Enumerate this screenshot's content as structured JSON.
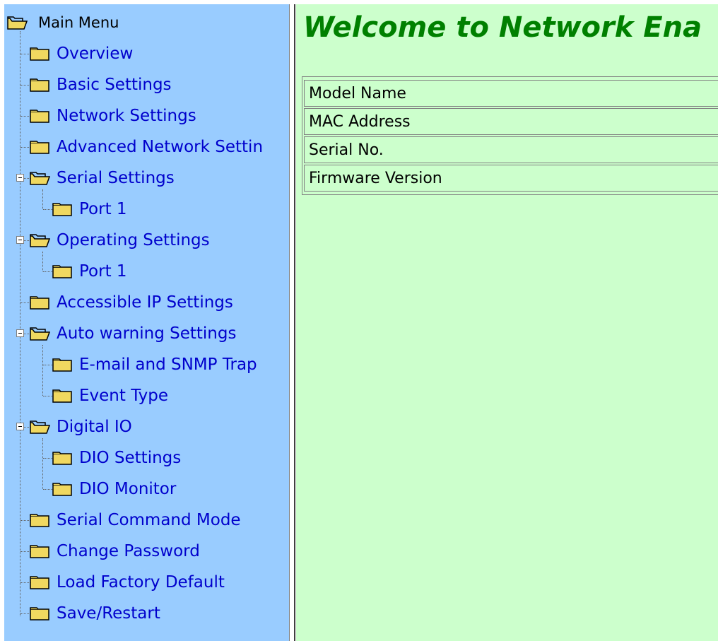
{
  "sidebar": {
    "root_label": "Main Menu",
    "items": [
      {
        "label": "Overview"
      },
      {
        "label": "Basic Settings"
      },
      {
        "label": "Network Settings"
      },
      {
        "label": "Advanced Network Settin"
      },
      {
        "label": "Serial Settings",
        "children": [
          {
            "label": "Port 1"
          }
        ]
      },
      {
        "label": "Operating Settings",
        "children": [
          {
            "label": "Port 1"
          }
        ]
      },
      {
        "label": "Accessible IP Settings"
      },
      {
        "label": "Auto warning Settings",
        "children": [
          {
            "label": "E-mail and SNMP Trap"
          },
          {
            "label": "Event Type"
          }
        ]
      },
      {
        "label": "Digital IO",
        "children": [
          {
            "label": "DIO Settings"
          },
          {
            "label": "DIO Monitor"
          }
        ]
      },
      {
        "label": "Serial Command Mode"
      },
      {
        "label": "Change Password"
      },
      {
        "label": "Load Factory Default"
      },
      {
        "label": "Save/Restart"
      }
    ]
  },
  "main": {
    "title": "Welcome to Network Ena",
    "info_rows": [
      {
        "label": "Model Name"
      },
      {
        "label": "MAC Address"
      },
      {
        "label": "Serial No."
      },
      {
        "label": "Firmware Version"
      }
    ]
  },
  "colors": {
    "sidebar_bg": "#99ccff",
    "main_bg": "#ccffcc",
    "link": "#0000cc",
    "title": "#008000"
  },
  "icons": {
    "folder": "folder-icon",
    "folder_open": "folder-open-icon",
    "toggle": "collapse-toggle-icon"
  }
}
